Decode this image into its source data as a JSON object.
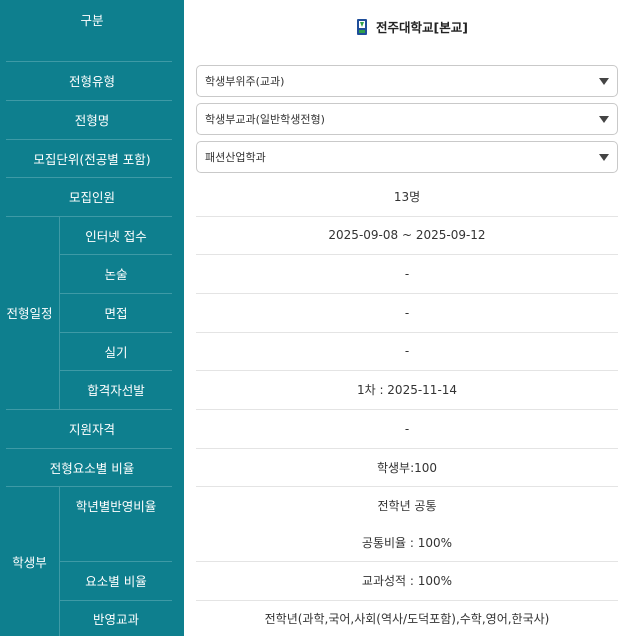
{
  "school": {
    "name": "전주대학교[본교]",
    "logo": "school-emblem",
    "logo_colors": [
      "#1f4e9a",
      "#2f9f4a"
    ]
  },
  "labels": {
    "category": "구분",
    "admission_type": "전형유형",
    "admission_name": "전형명",
    "recruit_unit": "모집단위(전공별 포함)",
    "recruit_count": "모집인원",
    "schedule_group": "전형일정",
    "schedule_internet": "인터넷 접수",
    "schedule_essay": "논술",
    "schedule_interview": "면접",
    "schedule_practical": "실기",
    "schedule_result": "합격자선발",
    "qualification": "지원자격",
    "element_ratio": "전형요소별 비율",
    "record_group": "학생부",
    "grade_ratio": "학년별반영비율",
    "record_element_ratio": "요소별 비율",
    "subjects": "반영교과"
  },
  "selects": {
    "admission_type": "학생부위주(교과)",
    "admission_name": "학생부교과(일반학생전형)",
    "recruit_unit": "패션산업학과"
  },
  "values": {
    "recruit_count": "13명",
    "schedule_internet": "2025-09-08 ~ 2025-09-12",
    "schedule_essay": "-",
    "schedule_interview": "-",
    "schedule_practical": "-",
    "schedule_result": "1차 : 2025-11-14",
    "qualification": "-",
    "element_ratio": "학생부:100",
    "grade_ratio_line1": "전학년 공통",
    "grade_ratio_line2": "공통비율 : 100%",
    "record_element_ratio": "교과성적 : 100%",
    "subjects": "전학년(과학,국어,사회(역사/도덕포함),수학,영어,한국사)"
  },
  "colors": {
    "label_bg": "#0e7f8e",
    "label_divider": "#3e9aa6",
    "value_divider": "#e4e4e4"
  }
}
